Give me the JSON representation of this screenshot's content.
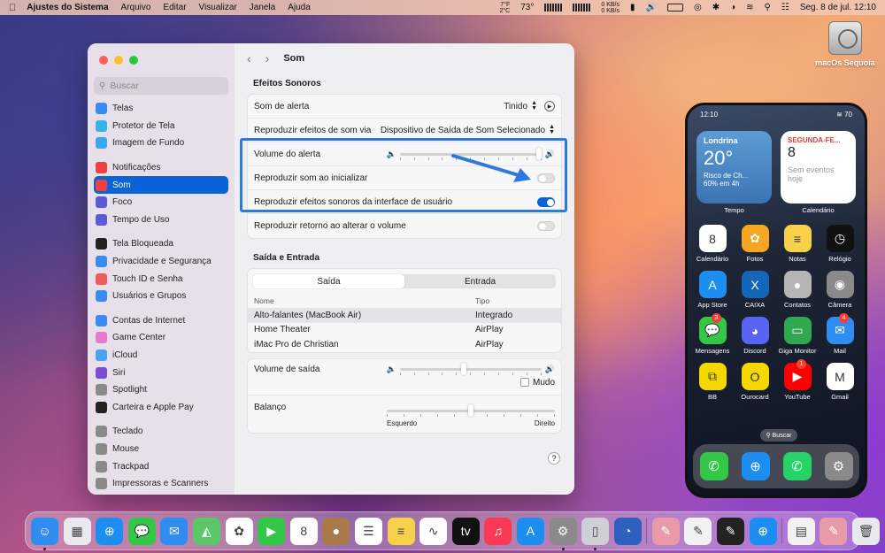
{
  "menubar": {
    "app_name": "Ajustes do Sistema",
    "menus": [
      "Arquivo",
      "Editar",
      "Visualizar",
      "Janela",
      "Ajuda"
    ],
    "temperature": "73°",
    "cpu_temp": "7°F",
    "cpu_temp2": "2°C",
    "net_up": "0 KB/s",
    "net_down": "0 KB/s",
    "datetime": "Seg. 8 de jul.  12:10"
  },
  "desktop": {
    "disk_label": "macOs Sequoia"
  },
  "window": {
    "title": "Som",
    "search_placeholder": "Buscar",
    "sidebar": [
      {
        "label": "Telas",
        "icon": "display-icon",
        "color": "#3b8cf0"
      },
      {
        "label": "Protetor de Tela",
        "icon": "screensaver-icon",
        "color": "#38b3e8"
      },
      {
        "label": "Imagem de Fundo",
        "icon": "wallpaper-icon",
        "color": "#3aa7f0"
      },
      {
        "label": "Notificações",
        "icon": "bell-icon",
        "color": "#f04040"
      },
      {
        "label": "Som",
        "icon": "speaker-icon",
        "color": "#f04040"
      },
      {
        "label": "Foco",
        "icon": "moon-icon",
        "color": "#5b5bd6"
      },
      {
        "label": "Tempo de Uso",
        "icon": "hourglass-icon",
        "color": "#5b5bd6"
      },
      {
        "label": "Tela Bloqueada",
        "icon": "lock-icon",
        "color": "#222222"
      },
      {
        "label": "Privacidade e Segurança",
        "icon": "hand-icon",
        "color": "#3b8cf0"
      },
      {
        "label": "Touch ID e Senha",
        "icon": "fingerprint-icon",
        "color": "#f05a5a"
      },
      {
        "label": "Usuários e Grupos",
        "icon": "users-icon",
        "color": "#3b8cf0"
      },
      {
        "label": "Contas de Internet",
        "icon": "at-icon",
        "color": "#3b8cf0"
      },
      {
        "label": "Game Center",
        "icon": "gamecenter-icon",
        "color": "#e67ad0"
      },
      {
        "label": "iCloud",
        "icon": "cloud-icon",
        "color": "#4aa3f0"
      },
      {
        "label": "Siri",
        "icon": "siri-icon",
        "color": "#7b4fd0"
      },
      {
        "label": "Spotlight",
        "icon": "search-icon",
        "color": "#8a8a8a"
      },
      {
        "label": "Carteira e Apple Pay",
        "icon": "wallet-icon",
        "color": "#222222"
      },
      {
        "label": "Teclado",
        "icon": "keyboard-icon",
        "color": "#8a8a8a"
      },
      {
        "label": "Mouse",
        "icon": "mouse-icon",
        "color": "#8a8a8a"
      },
      {
        "label": "Trackpad",
        "icon": "trackpad-icon",
        "color": "#8a8a8a"
      },
      {
        "label": "Impressoras e Scanners",
        "icon": "printer-icon",
        "color": "#8a8a8a"
      }
    ],
    "selected_index": 4,
    "effects": {
      "section_title": "Efeitos Sonoros",
      "alert_sound_label": "Som de alerta",
      "alert_sound_value": "Tinido",
      "play_through_label": "Reproduzir efeitos de som via",
      "play_through_value": "Dispositivo de Saída de Som Selecionado",
      "alert_volume_label": "Volume do alerta",
      "alert_volume_level": 1.0,
      "startup_label": "Reproduzir som ao inicializar",
      "startup_on": false,
      "ui_sounds_label": "Reproduzir efeitos sonoros da interface de usuário",
      "ui_sounds_on": true,
      "feedback_label": "Reproduzir retorno ao alterar o volume",
      "feedback_on": false
    },
    "io": {
      "section_title": "Saída e Entrada",
      "tab_output": "Saída",
      "tab_input": "Entrada",
      "col_name": "Nome",
      "col_type": "Tipo",
      "devices": [
        {
          "name": "Alto-falantes (MacBook Air)",
          "type": "Integrado"
        },
        {
          "name": "Home Theater",
          "type": "AirPlay"
        },
        {
          "name": "iMac Pro de Christian",
          "type": "AirPlay"
        }
      ],
      "output_volume_label": "Volume de saída",
      "output_volume_level": 0.45,
      "mute_label": "Mudo",
      "balance_label": "Balanço",
      "balance_left": "Esquerdo",
      "balance_right": "Direito",
      "balance_level": 0.5,
      "help": "?"
    }
  },
  "iphone": {
    "time": "12:10",
    "battery": "70",
    "weather": {
      "city": "Londrina",
      "temp": "20°",
      "cond1": "Risco de Ch...",
      "cond2": "60% em 4h",
      "label": "Tempo"
    },
    "calendar": {
      "day": "SEGUNDA-FE...",
      "num": "8",
      "events": "Sem eventos hoje",
      "label": "Calendário"
    },
    "apps": [
      {
        "label": "Calendário",
        "icon": "calendar-icon",
        "color": "#ffffff",
        "glyph": "8"
      },
      {
        "label": "Fotos",
        "icon": "photos-icon",
        "color": "#f5a623",
        "glyph": "✿"
      },
      {
        "label": "Notas",
        "icon": "notes-icon",
        "color": "#f7d14a",
        "glyph": "≡"
      },
      {
        "label": "Relógio",
        "icon": "clock-icon",
        "color": "#111111",
        "glyph": "◷"
      },
      {
        "label": "App Store",
        "icon": "appstore-icon",
        "color": "#1c8ef2",
        "glyph": "A"
      },
      {
        "label": "CAIXA",
        "icon": "caixa-icon",
        "color": "#1466b8",
        "glyph": "X"
      },
      {
        "label": "Contatos",
        "icon": "contacts-icon",
        "color": "#b5b5b5",
        "glyph": "●"
      },
      {
        "label": "Câmera",
        "icon": "camera-icon",
        "color": "#8a8a8a",
        "glyph": "◉"
      },
      {
        "label": "Mensagens",
        "icon": "messages-icon",
        "color": "#33c748",
        "glyph": "💬",
        "badge": "3"
      },
      {
        "label": "Discord",
        "icon": "discord-icon",
        "color": "#5865f2",
        "glyph": "◕"
      },
      {
        "label": "Giga Monitor",
        "icon": "gigamonitor-icon",
        "color": "#2fa84f",
        "glyph": "▭"
      },
      {
        "label": "Mail",
        "icon": "mail-icon",
        "color": "#2f8cf0",
        "glyph": "✉",
        "badge": "4"
      },
      {
        "label": "BB",
        "icon": "bb-icon",
        "color": "#f5d800",
        "glyph": "⧉"
      },
      {
        "label": "Ourocard",
        "icon": "ourocard-icon",
        "color": "#f5d800",
        "glyph": "O"
      },
      {
        "label": "YouTube",
        "icon": "youtube-icon",
        "color": "#ff0000",
        "glyph": "▶",
        "badge": "1"
      },
      {
        "label": "Gmail",
        "icon": "gmail-icon",
        "color": "#ffffff",
        "glyph": "M"
      }
    ],
    "search_label": "Buscar",
    "dock": [
      {
        "icon": "phone-icon",
        "color": "#33c748",
        "glyph": "✆"
      },
      {
        "icon": "safari-icon",
        "color": "#1c8ef2",
        "glyph": "⊕"
      },
      {
        "icon": "whatsapp-icon",
        "color": "#25d366",
        "glyph": "✆"
      },
      {
        "icon": "settings-icon",
        "color": "#8a8a8a",
        "glyph": "⚙"
      }
    ]
  },
  "dock": [
    {
      "icon": "finder-icon",
      "color": "#2f8cf0",
      "glyph": "☺",
      "run": true
    },
    {
      "icon": "launchpad-icon",
      "color": "#e8e8ee",
      "glyph": "▦"
    },
    {
      "icon": "safari-icon",
      "color": "#1c8ef2",
      "glyph": "⊕"
    },
    {
      "icon": "messages-icon",
      "color": "#33c748",
      "glyph": "💬"
    },
    {
      "icon": "mail-icon",
      "color": "#2f8cf0",
      "glyph": "✉"
    },
    {
      "icon": "maps-icon",
      "color": "#5cc66a",
      "glyph": "◭"
    },
    {
      "icon": "photos-icon",
      "color": "#ffffff",
      "glyph": "✿"
    },
    {
      "icon": "facetime-icon",
      "color": "#33c748",
      "glyph": "▶"
    },
    {
      "icon": "calendar-icon",
      "color": "#ffffff",
      "glyph": "8"
    },
    {
      "icon": "contacts-icon",
      "color": "#a87a4a",
      "glyph": "●"
    },
    {
      "icon": "reminders-icon",
      "color": "#ffffff",
      "glyph": "☰"
    },
    {
      "icon": "notes-icon",
      "color": "#f7d14a",
      "glyph": "≡"
    },
    {
      "icon": "freeform-icon",
      "color": "#ffffff",
      "glyph": "∿"
    },
    {
      "icon": "appletv-icon",
      "color": "#111111",
      "glyph": "tv"
    },
    {
      "icon": "music-icon",
      "color": "#fa3a55",
      "glyph": "♫"
    },
    {
      "icon": "appstore-icon",
      "color": "#1c8ef2",
      "glyph": "A"
    },
    {
      "icon": "settings-icon",
      "color": "#8a8a8a",
      "glyph": "⚙",
      "run": true
    },
    {
      "icon": "iphone-mirroring-icon",
      "color": "#cfcfd6",
      "glyph": "▯",
      "run": true
    },
    {
      "icon": "instruments-icon",
      "color": "#2f5fbf",
      "glyph": "◔"
    },
    {
      "sep": true
    },
    {
      "icon": "preview-icon",
      "color": "#e89aa8",
      "glyph": "✎"
    },
    {
      "icon": "textedit-icon",
      "color": "#f2f2f2",
      "glyph": "✎"
    },
    {
      "icon": "pdf-icon",
      "color": "#222222",
      "glyph": "✎"
    },
    {
      "icon": "safari-tech-icon",
      "color": "#1c8ef2",
      "glyph": "⊕"
    },
    {
      "sep": true
    },
    {
      "icon": "downloads-icon",
      "color": "#f2f2f2",
      "glyph": "▤"
    },
    {
      "icon": "stack-icon",
      "color": "#e89aa8",
      "glyph": "✎"
    },
    {
      "icon": "trash-icon",
      "color": "#e8e8ee",
      "glyph": "🗑"
    }
  ]
}
